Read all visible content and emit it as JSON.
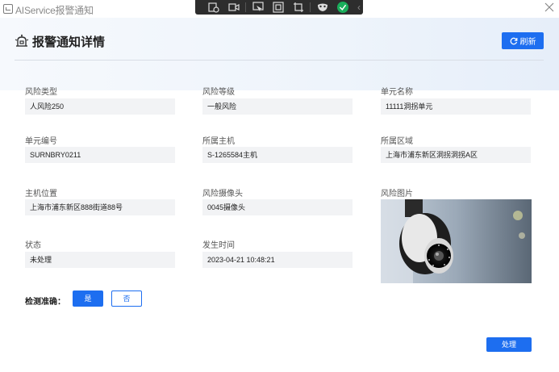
{
  "window": {
    "title": "AIService报警通知"
  },
  "header": {
    "title": "报警通知详情",
    "refresh_label": "刷新"
  },
  "fields": {
    "risk_type": {
      "label": "风险类型",
      "value": "人风险250"
    },
    "risk_level": {
      "label": "风险等级",
      "value": "一般风险"
    },
    "unit_name": {
      "label": "单元名称",
      "value": "11111洞拐单元"
    },
    "unit_code": {
      "label": "单元编号",
      "value": "SURNBRY0211"
    },
    "host": {
      "label": "所属主机",
      "value": "S-1265584主机"
    },
    "region": {
      "label": "所属区域",
      "value": "上海市浦东新区洞拐洞拐A区"
    },
    "host_location": {
      "label": "主机位置",
      "value": "上海市浦东新区888街道88号"
    },
    "camera": {
      "label": "风险摄像头",
      "value": "0045摄像头"
    },
    "risk_image": {
      "label": "风险图片"
    },
    "status": {
      "label": "状态",
      "value": "未处理"
    },
    "time": {
      "label": "发生时间",
      "value": "2023-04-21 10:48:21"
    }
  },
  "detection": {
    "label": "检测准确：",
    "yes_label": "是",
    "no_label": "否"
  },
  "actions": {
    "handle_label": "处理"
  },
  "colors": {
    "primary": "#1d6ef0",
    "field_bg": "#f2f3f5",
    "toolbar_bg": "#2d2d2d"
  }
}
